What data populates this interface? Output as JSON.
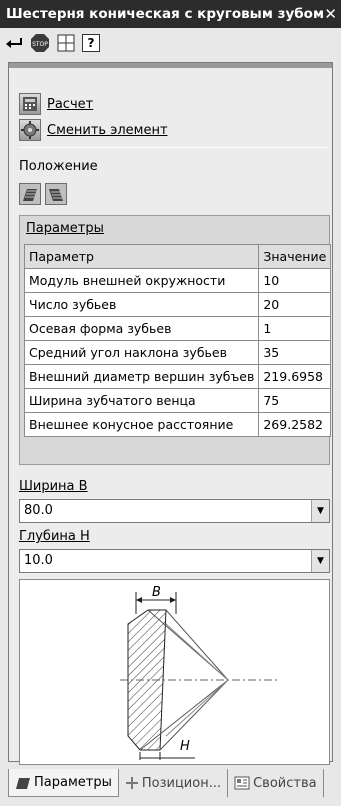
{
  "window": {
    "title": "Шестерня коническая с круговым зубом",
    "close_glyph": "✕"
  },
  "toolbar": {
    "icons": [
      "enter-icon",
      "stop-icon",
      "grid-icon",
      "help-icon"
    ],
    "help_glyph": "?"
  },
  "commands": {
    "calc_label": "Расчет",
    "change_label": "Сменить элемент"
  },
  "position": {
    "label": "Положение"
  },
  "params": {
    "title": "Параметры",
    "headers": [
      "Параметр",
      "Значение"
    ],
    "rows": [
      [
        "Модуль внешней окружности",
        "10"
      ],
      [
        "Число зубьев",
        "20"
      ],
      [
        "Осевая форма зубьев",
        "1"
      ],
      [
        "Средний угол наклона зубьев",
        "35"
      ],
      [
        "Внешний диаметр вершин зубъев",
        "219.6958"
      ],
      [
        "Ширина зубчатого венца",
        "75"
      ],
      [
        "Внешнее конусное расстояние",
        "269.2582"
      ]
    ]
  },
  "width_field": {
    "label": "Ширина В",
    "value": "80.0"
  },
  "depth_field": {
    "label": "Глубина Н",
    "value": "10.0"
  },
  "drawing": {
    "label_b": "В",
    "label_h": "Н"
  },
  "tabs": [
    "Параметры",
    "Позицион...",
    "Свойства"
  ]
}
